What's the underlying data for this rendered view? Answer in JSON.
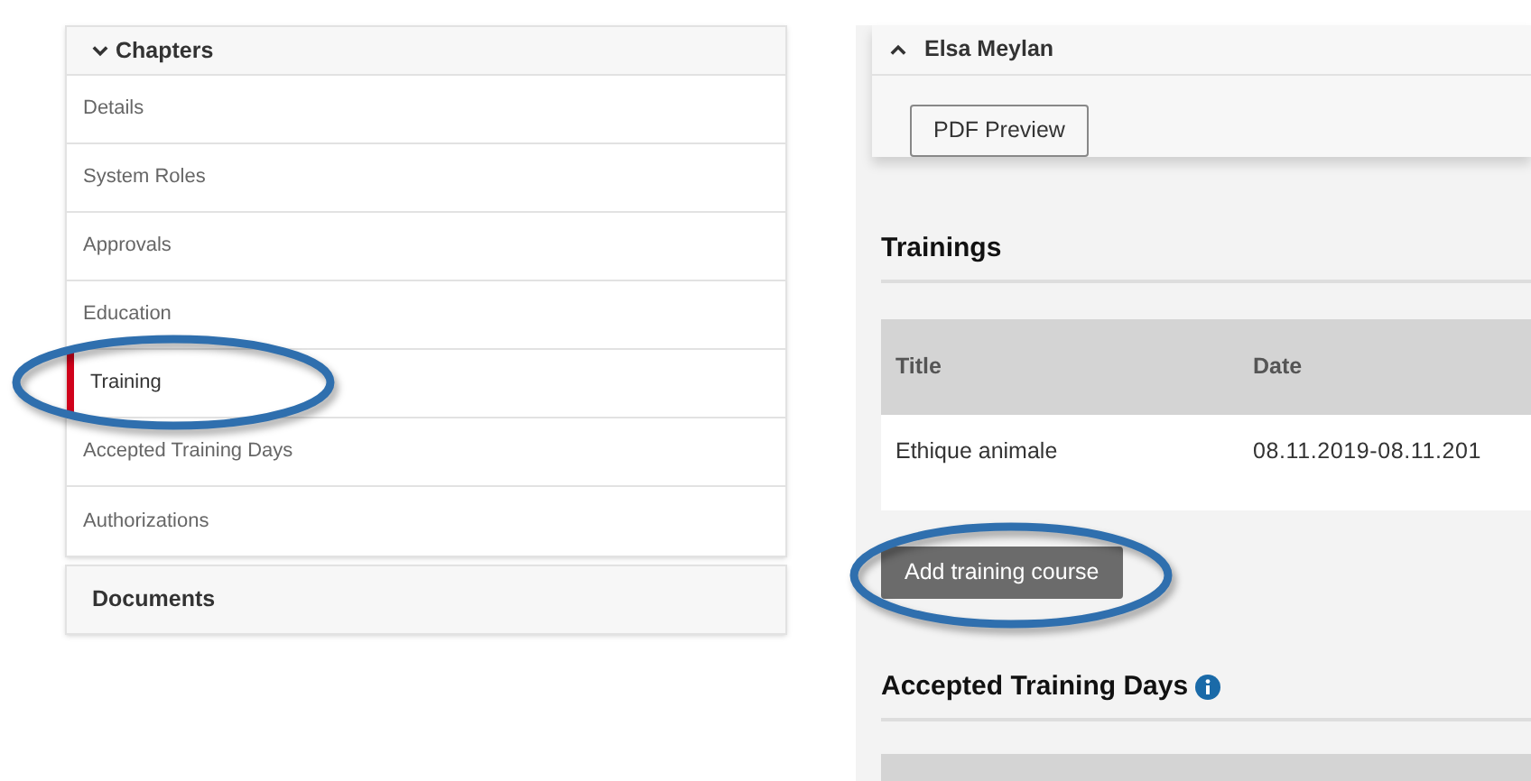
{
  "sidebar": {
    "header": {
      "label": "Chapters",
      "expanded": true
    },
    "items": [
      {
        "label": "Details",
        "selected": false
      },
      {
        "label": "System Roles",
        "selected": false
      },
      {
        "label": "Approvals",
        "selected": false
      },
      {
        "label": "Education",
        "selected": false
      },
      {
        "label": "Training",
        "selected": true
      },
      {
        "label": "Accepted Training Days",
        "selected": false
      },
      {
        "label": "Authorizations",
        "selected": false
      }
    ],
    "documents": "Documents"
  },
  "person_card": {
    "name": "Elsa Meylan",
    "expanded": true,
    "button": "PDF Preview"
  },
  "trainings": {
    "heading": "Trainings",
    "columns": [
      "Title",
      "Date"
    ],
    "rows": [
      [
        "Ethique animale",
        "08.11.2019-08.11.201"
      ]
    ],
    "add_button": "Add training course"
  },
  "accepted_days": {
    "heading": "Accepted Training Days"
  }
}
